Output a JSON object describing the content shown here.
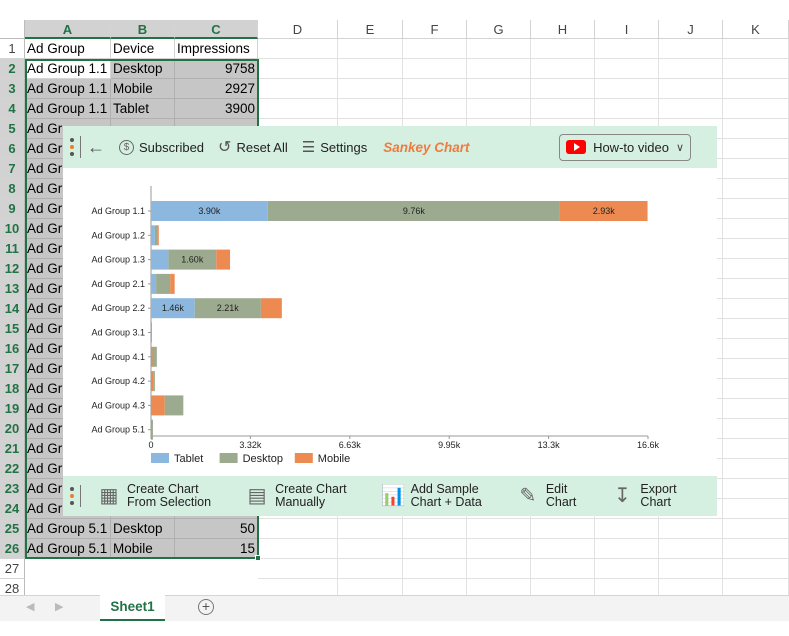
{
  "columns": [
    "A",
    "B",
    "C",
    "D",
    "E",
    "F",
    "G",
    "H",
    "I",
    "J",
    "K"
  ],
  "rows": [
    "1",
    "2",
    "3",
    "4",
    "5",
    "6",
    "7",
    "8",
    "9",
    "10",
    "11",
    "12",
    "13",
    "14",
    "15",
    "16",
    "17",
    "18",
    "19",
    "20",
    "21",
    "22",
    "23",
    "24",
    "25",
    "26",
    "27",
    "28"
  ],
  "header_row": [
    "Ad Group",
    "Device",
    "Impressions"
  ],
  "top_rows": [
    [
      "Ad Group 1.1",
      "Desktop",
      "9758"
    ],
    [
      "Ad Group 1.1",
      "Mobile",
      "2927"
    ],
    [
      "Ad Group 1.1",
      "Tablet",
      "3900"
    ]
  ],
  "partial_label": "Ad Gr",
  "bottom_rows": [
    [
      "Ad Group 5.1",
      "Desktop",
      "50"
    ],
    [
      "Ad Group 5.1",
      "Mobile",
      "15"
    ]
  ],
  "sheet_tab": "Sheet1",
  "toolbar": {
    "subscribed": "Subscribed",
    "reset": "Reset All",
    "settings": "Settings",
    "chart_name": "Sankey Chart",
    "video": "How-to video"
  },
  "bottom_toolbar": [
    {
      "l1": "Create Chart",
      "l2": "From Selection",
      "icon": "table-grid-icon"
    },
    {
      "l1": "Create Chart",
      "l2": "Manually",
      "icon": "form-layout-icon"
    },
    {
      "l1": "Add Sample",
      "l2": "Chart + Data",
      "icon": "sample-data-icon"
    },
    {
      "l1": "Edit",
      "l2": "Chart",
      "icon": "edit-chart-icon"
    },
    {
      "l1": "Export",
      "l2": "Chart",
      "icon": "export-chart-icon"
    }
  ],
  "chart_data": {
    "type": "bar",
    "orientation": "horizontal-stacked",
    "categories": [
      "Ad Group 1.1",
      "Ad Group 1.2",
      "Ad Group 1.3",
      "Ad Group 2.1",
      "Ad Group 2.2",
      "Ad Group 3.1",
      "Ad Group 4.1",
      "Ad Group 4.2",
      "Ad Group 4.3",
      "Ad Group 5.1"
    ],
    "colors": {
      "Tablet": "#8cb8e0",
      "Desktop": "#9cab8f",
      "Mobile": "#ec8a52"
    },
    "legend": [
      "Tablet",
      "Desktop",
      "Mobile"
    ],
    "legend_position": "bottom-left",
    "xlim": [
      0,
      16600
    ],
    "xticks": [
      "0",
      "3.32k",
      "6.63k",
      "9.95k",
      "13.3k",
      "16.6k"
    ],
    "grid": false,
    "stacks": [
      [
        [
          "Tablet",
          3900
        ],
        [
          "Desktop",
          9758
        ],
        [
          "Mobile",
          2927
        ]
      ],
      [
        [
          "Tablet",
          130
        ],
        [
          "Desktop",
          90
        ],
        [
          "Mobile",
          40
        ]
      ],
      [
        [
          "Tablet",
          580
        ],
        [
          "Desktop",
          1600
        ],
        [
          "Mobile",
          460
        ]
      ],
      [
        [
          "Tablet",
          170
        ],
        [
          "Desktop",
          470
        ],
        [
          "Mobile",
          150
        ]
      ],
      [
        [
          "Tablet",
          1460
        ],
        [
          "Desktop",
          2210
        ],
        [
          "Mobile",
          700
        ]
      ],
      [
        [
          "Mobile",
          30
        ]
      ],
      [
        [
          "Mobile",
          50
        ],
        [
          "Desktop",
          145
        ]
      ],
      [
        [
          "Mobile",
          80
        ],
        [
          "Desktop",
          50
        ]
      ],
      [
        [
          "Mobile",
          460
        ],
        [
          "Desktop",
          620
        ]
      ],
      [
        [
          "Mobile",
          15
        ],
        [
          "Desktop",
          50
        ]
      ]
    ]
  }
}
